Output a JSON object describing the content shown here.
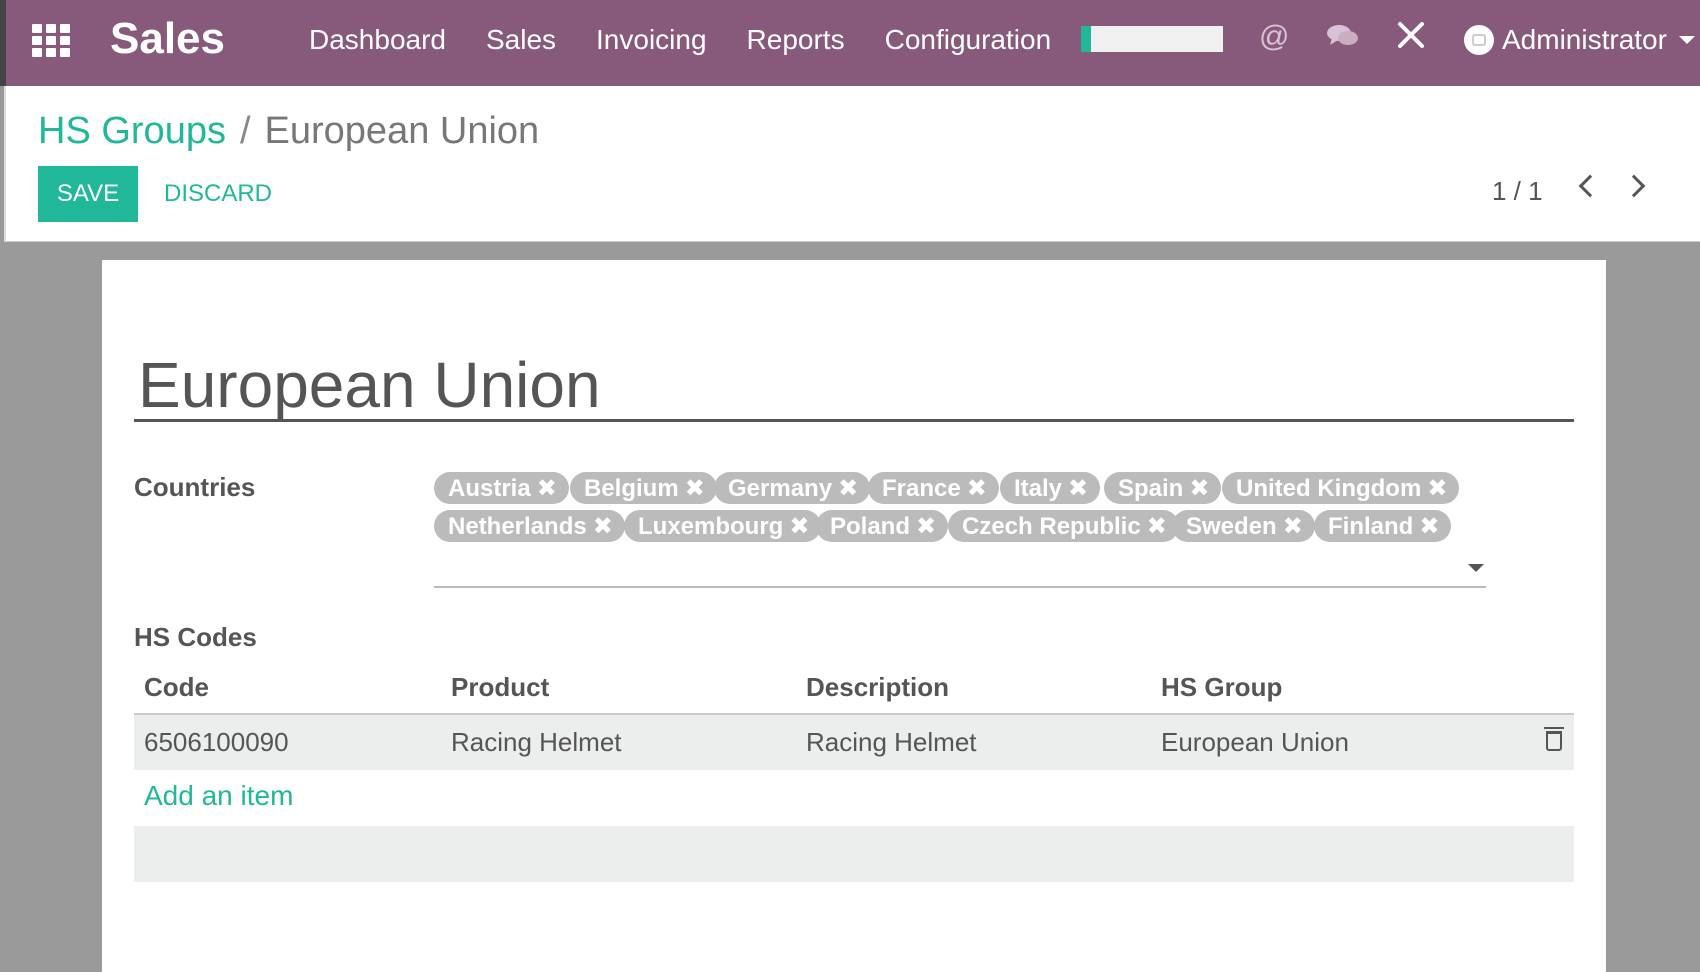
{
  "navbar": {
    "brand": "Sales",
    "menu": [
      "Dashboard",
      "Sales",
      "Invoicing",
      "Reports",
      "Configuration"
    ],
    "at_icon": "@",
    "user": "Administrator",
    "color": "#875a7b"
  },
  "control": {
    "breadcrumb_parent": "HS Groups",
    "breadcrumb_sep": "/",
    "breadcrumb_current": "European Union",
    "save_label": "SAVE",
    "discard_label": "DISCARD",
    "pager": "1 / 1",
    "accent_color": "#21b799"
  },
  "form": {
    "name": "European Union",
    "countries_label": "Countries",
    "countries": [
      "Austria",
      "Belgium",
      "Germany",
      "France",
      "Italy",
      "Spain",
      "United Kingdom",
      "Netherlands",
      "Luxembourg",
      "Poland",
      "Czech Republic",
      "Sweden",
      "Finland"
    ],
    "hs_codes_label": "HS Codes",
    "table": {
      "headers": [
        "Code",
        "Product",
        "Description",
        "HS Group"
      ],
      "rows": [
        [
          "6506100090",
          "Racing Helmet",
          "Racing Helmet",
          "European Union"
        ]
      ]
    },
    "add_item": "Add an item"
  }
}
